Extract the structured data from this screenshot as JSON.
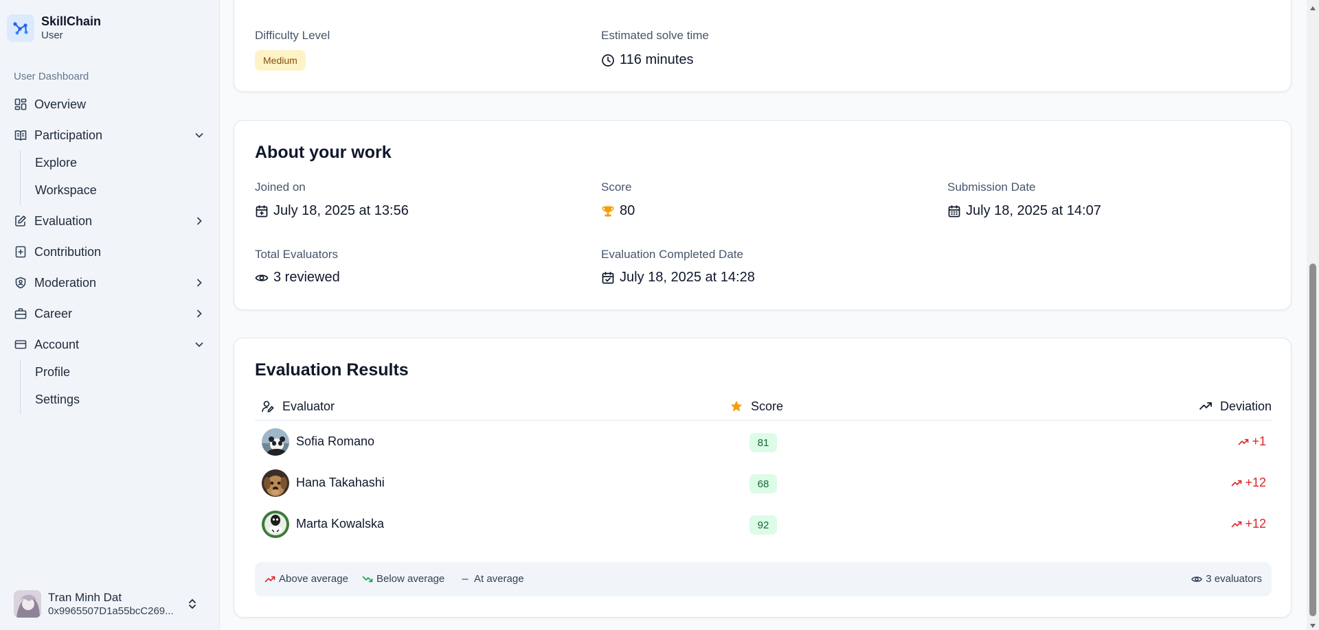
{
  "brand": {
    "name": "SkillChain",
    "role": "User"
  },
  "sidebar": {
    "group_label": "User Dashboard",
    "items": {
      "overview": "Overview",
      "participation": "Participation",
      "explore": "Explore",
      "workspace": "Workspace",
      "evaluation": "Evaluation",
      "contribution": "Contribution",
      "moderation": "Moderation",
      "career": "Career",
      "account": "Account",
      "profile": "Profile",
      "settings": "Settings"
    }
  },
  "user": {
    "name": "Tran Minh Dat",
    "address": "0x9965507D1a55bcC269..."
  },
  "challenge_info": {
    "difficulty_label": "Difficulty Level",
    "difficulty_value": "Medium",
    "solve_time_label": "Estimated solve time",
    "solve_time_value": "116 minutes"
  },
  "about": {
    "title": "About your work",
    "joined_label": "Joined on",
    "joined_value": "July 18, 2025 at 13:56",
    "score_label": "Score",
    "score_value": "80",
    "submission_label": "Submission Date",
    "submission_value": "July 18, 2025 at 14:07",
    "evaluators_label": "Total Evaluators",
    "evaluators_value": "3 reviewed",
    "completed_label": "Evaluation Completed Date",
    "completed_value": "July 18, 2025 at 14:28"
  },
  "results": {
    "title": "Evaluation Results",
    "columns": {
      "evaluator": "Evaluator",
      "score": "Score",
      "deviation": "Deviation"
    },
    "rows": [
      {
        "name": "Sofia Romano",
        "score": "81",
        "deviation": "+1"
      },
      {
        "name": "Hana Takahashi",
        "score": "68",
        "deviation": "+12"
      },
      {
        "name": "Marta Kowalska",
        "score": "92",
        "deviation": "+12"
      }
    ],
    "legend": {
      "above": "Above average",
      "below": "Below average",
      "at": "At average",
      "count": "3 evaluators"
    }
  },
  "colors": {
    "accent_blue": "#2563eb",
    "badge_medium_bg": "#fef3c7",
    "score_badge_bg": "#dcfce7",
    "deviation_red": "#dc2626",
    "trophy": "#f59e0b"
  }
}
